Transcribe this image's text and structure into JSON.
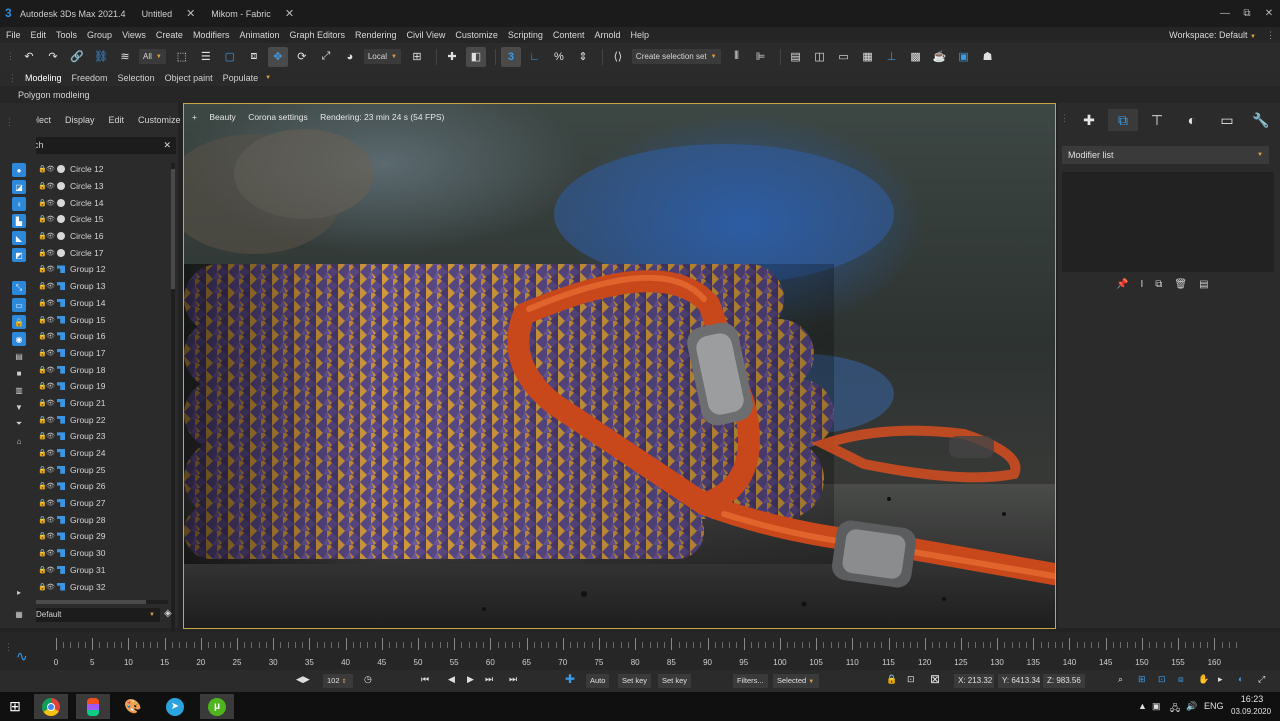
{
  "titlebar": {
    "tabs": [
      {
        "label": "Autodesk 3Ds Max 2021.4",
        "closable": false
      },
      {
        "label": "Untitled",
        "closable": true
      },
      {
        "label": "Mikom - Fabric",
        "closable": true
      }
    ],
    "window_controls": [
      "—",
      "⧉",
      "✕"
    ]
  },
  "menubar": {
    "items": [
      "File",
      "Edit",
      "Tools",
      "Group",
      "Views",
      "Create",
      "Modifiers",
      "Animation",
      "Graph Editors",
      "Rendering",
      "Civil View",
      "Customize",
      "Scripting",
      "Content",
      "Arnold",
      "Help"
    ],
    "workspace_label": "Workspace: Default"
  },
  "toolbar": {
    "filter_dropdown": "All",
    "coord_dropdown": "Local",
    "selection_set": "Create selection set"
  },
  "ribbon": {
    "tabs": [
      "Modeling",
      "Freedom",
      "Selection",
      "Object paint",
      "Populate"
    ],
    "sub_label": "Polygon modleing"
  },
  "explorer": {
    "tabs": [
      "Select",
      "Display",
      "Edit",
      "Customize"
    ],
    "search_placeholder": "Seach",
    "items": [
      {
        "name": "Circle 12",
        "type": "circle"
      },
      {
        "name": "Circle 13",
        "type": "circle"
      },
      {
        "name": "Circle 14",
        "type": "circle"
      },
      {
        "name": "Circle 15",
        "type": "circle"
      },
      {
        "name": "Circle 16",
        "type": "circle"
      },
      {
        "name": "Circle 17",
        "type": "circle"
      },
      {
        "name": "Group 12",
        "type": "group"
      },
      {
        "name": "Group 13",
        "type": "group"
      },
      {
        "name": "Group 14",
        "type": "group"
      },
      {
        "name": "Group 15",
        "type": "group"
      },
      {
        "name": "Group 16",
        "type": "group"
      },
      {
        "name": "Group 17",
        "type": "group"
      },
      {
        "name": "Group 18",
        "type": "group"
      },
      {
        "name": "Group 19",
        "type": "group"
      },
      {
        "name": "Group 21",
        "type": "group"
      },
      {
        "name": "Group 22",
        "type": "group"
      },
      {
        "name": "Group 23",
        "type": "group"
      },
      {
        "name": "Group 24",
        "type": "group"
      },
      {
        "name": "Group 25",
        "type": "group"
      },
      {
        "name": "Group 26",
        "type": "group"
      },
      {
        "name": "Group 27",
        "type": "group"
      },
      {
        "name": "Group 28",
        "type": "group"
      },
      {
        "name": "Group 29",
        "type": "group"
      },
      {
        "name": "Group 30",
        "type": "group"
      },
      {
        "name": "Group 31",
        "type": "group"
      },
      {
        "name": "Group 32",
        "type": "group"
      }
    ],
    "layer": "Default"
  },
  "viewport": {
    "beauty": "Beauty",
    "corona": "Corona settings",
    "status": "Rendering: 23 min 24 s (54 FPS)"
  },
  "command_panel": {
    "modifier_list": "Modifier list"
  },
  "timeline": {
    "labels": [
      "0",
      "5",
      "10",
      "15",
      "20",
      "25",
      "30",
      "35",
      "40",
      "45",
      "50",
      "55",
      "60",
      "65",
      "70",
      "75",
      "80",
      "85",
      "90",
      "95",
      "100",
      "105",
      "110",
      "115",
      "120",
      "125",
      "130",
      "135",
      "140",
      "145",
      "150",
      "155",
      "160"
    ]
  },
  "anim": {
    "frame": "102",
    "auto": "Auto",
    "set_key": "Set key",
    "set_key2": "Set key",
    "filters": "Filters...",
    "selected": "Selected",
    "x": "X: 213.32",
    "y": "Y: 6413.34",
    "z": "Z: 983.56"
  },
  "taskbar": {
    "lang": "ENG",
    "time": "16:23",
    "date": "03.09.2020"
  },
  "colors": {
    "accent": "#2c88d9",
    "viewport_border": "#c8a347",
    "dropdown_caret": "#e0a040"
  }
}
